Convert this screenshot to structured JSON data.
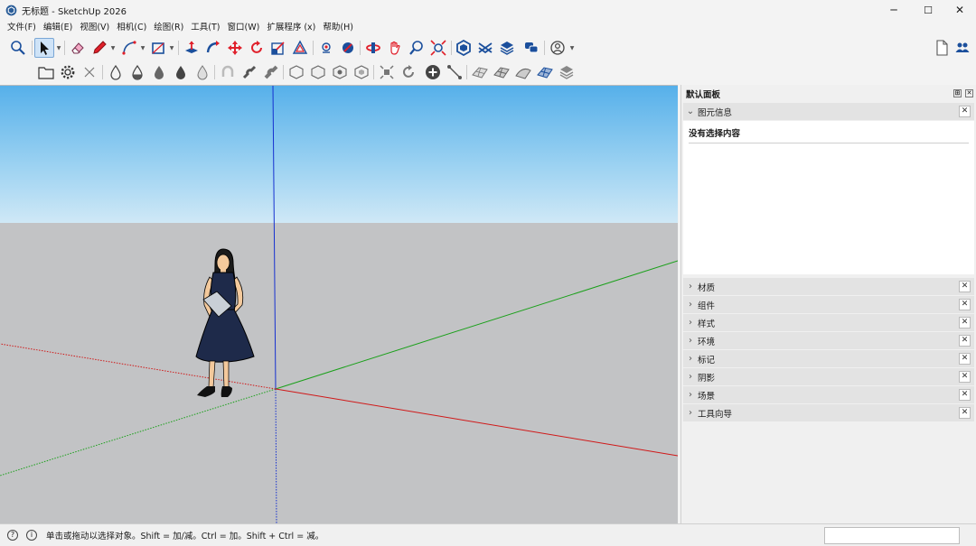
{
  "window": {
    "title": "无标题 - SketchUp 2026",
    "controls": {
      "minimize": "─",
      "maximize": "☐",
      "close": "✕"
    }
  },
  "menu": [
    "文件(F)",
    "编辑(E)",
    "视图(V)",
    "相机(C)",
    "绘图(R)",
    "工具(T)",
    "窗口(W)",
    "扩展程序 (x)",
    "帮助(H)"
  ],
  "toolbar": {
    "row1": [
      "zoom-icon",
      "select-icon",
      "eraser-icon",
      "pencil-icon",
      "arc-icon",
      "rectangle-icon",
      "push-pull-icon",
      "follow-me-icon",
      "move-icon",
      "rotate-icon",
      "scale-icon",
      "offset-icon",
      "walk-icon",
      "orbit-icon",
      "pan-icon",
      "zoom-window-icon",
      "zoom-extents-icon",
      "section-icon",
      "warehouse-icon",
      "extension-warehouse-icon",
      "layout-icon",
      "account-icon"
    ],
    "row2": [
      "folder-icon",
      "gear-icon",
      "x-axis-icon",
      "drop-icons",
      "solid-tools-icons",
      "sandbox-icons"
    ]
  },
  "colors": {
    "axis_red": "#d01818",
    "axis_green": "#1aa01a",
    "axis_blue": "#1530d0",
    "sky_top": "#56b0ea",
    "ground": "#c2c3c5",
    "dress": "#1e2a4a"
  },
  "tray": {
    "title": "默认面板",
    "entity_info": {
      "label": "图元信息",
      "empty_text": "没有选择内容"
    },
    "sections": [
      "材质",
      "组件",
      "样式",
      "环境",
      "标记",
      "阴影",
      "场景",
      "工具向导"
    ]
  },
  "status": {
    "text": "单击或拖动以选择对象。Shift = 加/减。Ctrl = 加。Shift + Ctrl = 减。",
    "measurements_value": ""
  }
}
